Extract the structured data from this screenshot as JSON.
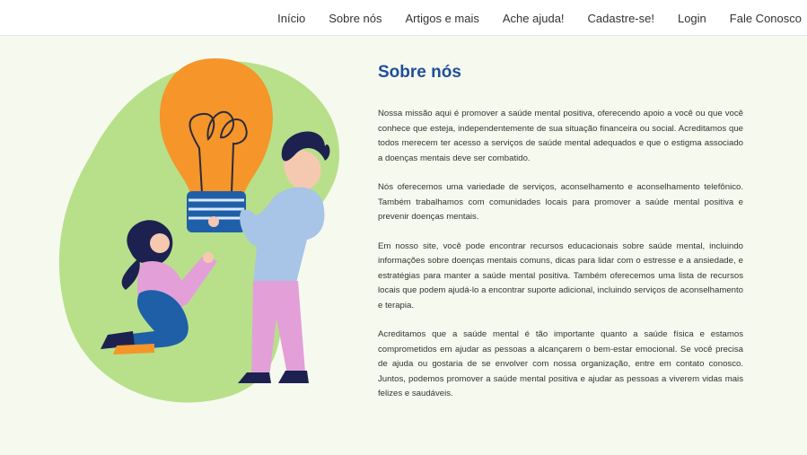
{
  "nav": {
    "items": [
      {
        "label": "Início",
        "name": "nav-inicio"
      },
      {
        "label": "Sobre nós",
        "name": "nav-sobre-nos"
      },
      {
        "label": "Artigos e mais",
        "name": "nav-artigos"
      },
      {
        "label": "Ache ajuda!",
        "name": "nav-ache-ajuda"
      },
      {
        "label": "Cadastre-se!",
        "name": "nav-cadastre-se"
      },
      {
        "label": "Login",
        "name": "nav-login"
      },
      {
        "label": "Fale Conosco",
        "name": "nav-fale-conosco"
      }
    ]
  },
  "main": {
    "title": "Sobre nós",
    "paragraphs": [
      "Nossa missão aqui é promover a saúde mental positiva, oferecendo apoio a você ou que você conhece que esteja, independentemente de sua situação financeira ou social. Acreditamos que todos merecem ter acesso a serviços de saúde mental adequados e que o estigma associado a doenças mentais deve ser combatido.",
      "Nós oferecemos uma variedade de serviços,  aconselhamento e aconselhamento telefônico. Também trabalhamos com comunidades locais para promover a saúde mental positiva e prevenir doenças mentais.",
      "Em nosso site, você pode encontrar recursos educacionais sobre saúde mental, incluindo informações sobre doenças mentais comuns, dicas para lidar com o estresse e a ansiedade, e estratégias para manter a saúde mental positiva. Também oferecemos uma lista de recursos locais que podem ajudá-lo a encontrar suporte adicional, incluindo serviços de aconselhamento e terapia.",
      "Acreditamos que a saúde mental é tão importante quanto a saúde física e estamos comprometidos em ajudar as pessoas a alcançarem o bem-estar emocional. Se você precisa de ajuda ou gostaria de se envolver com nossa organização, entre em contato conosco. Juntos, podemos promover a saúde mental positiva e ajudar as pessoas a viverem vidas mais felizes e saudáveis."
    ]
  },
  "colors": {
    "accent": "#1f4f9a",
    "blob": "#b8e08a",
    "bulb": "#f5952a",
    "background": "#f6faee"
  }
}
